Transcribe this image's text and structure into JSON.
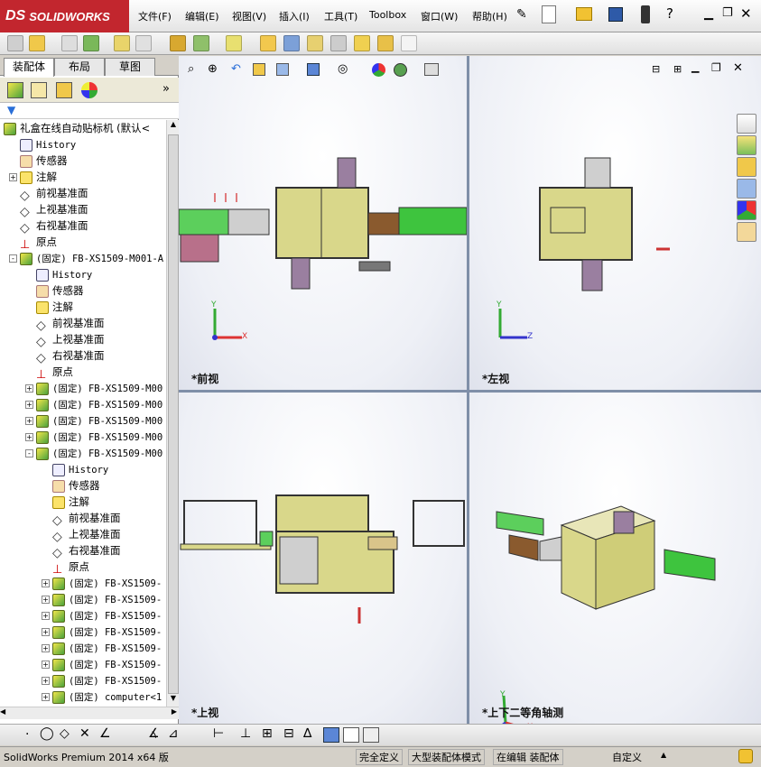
{
  "app": {
    "brand": "SOLIDWORKS",
    "brand_mark": "DS"
  },
  "menu": [
    "文件(F)",
    "编辑(E)",
    "视图(V)",
    "插入(I)",
    "工具(T)",
    "Toolbox",
    "窗口(W)",
    "帮助(H)"
  ],
  "tabs": [
    "装配体",
    "布局",
    "草图"
  ],
  "tree": {
    "root": "礼盒在线自动贴标机  (默认<",
    "items": [
      {
        "icon": "hist",
        "label": "History",
        "indent": 1,
        "mono": true
      },
      {
        "icon": "sens",
        "label": "传感器",
        "indent": 1
      },
      {
        "icon": "note",
        "label": "注解",
        "indent": 1,
        "expand": "+"
      },
      {
        "icon": "plane",
        "label": "前视基准面",
        "indent": 1
      },
      {
        "icon": "plane",
        "label": "上视基准面",
        "indent": 1
      },
      {
        "icon": "plane",
        "label": "右视基准面",
        "indent": 1
      },
      {
        "icon": "orig",
        "label": "原点",
        "indent": 1
      },
      {
        "icon": "asm",
        "label": "(固定) FB-XS1509-M001-A",
        "indent": 1,
        "expand": "-",
        "mono": true
      },
      {
        "icon": "hist",
        "label": "History",
        "indent": 2,
        "mono": true
      },
      {
        "icon": "sens",
        "label": "传感器",
        "indent": 2
      },
      {
        "icon": "note",
        "label": "注解",
        "indent": 2
      },
      {
        "icon": "plane",
        "label": "前视基准面",
        "indent": 2
      },
      {
        "icon": "plane",
        "label": "上视基准面",
        "indent": 2
      },
      {
        "icon": "plane",
        "label": "右视基准面",
        "indent": 2
      },
      {
        "icon": "orig",
        "label": "原点",
        "indent": 2
      },
      {
        "icon": "asm",
        "label": "(固定) FB-XS1509-M00",
        "indent": 2,
        "expand": "+",
        "mono": true
      },
      {
        "icon": "asm",
        "label": "(固定) FB-XS1509-M00",
        "indent": 2,
        "expand": "+",
        "mono": true
      },
      {
        "icon": "asm",
        "label": "(固定) FB-XS1509-M00",
        "indent": 2,
        "expand": "+",
        "mono": true
      },
      {
        "icon": "asm",
        "label": "(固定) FB-XS1509-M00",
        "indent": 2,
        "expand": "+",
        "mono": true
      },
      {
        "icon": "asm",
        "label": "(固定) FB-XS1509-M00",
        "indent": 2,
        "expand": "-",
        "mono": true
      },
      {
        "icon": "hist",
        "label": "History",
        "indent": 3,
        "mono": true
      },
      {
        "icon": "sens",
        "label": "传感器",
        "indent": 3
      },
      {
        "icon": "note",
        "label": "注解",
        "indent": 3
      },
      {
        "icon": "plane",
        "label": "前视基准面",
        "indent": 3
      },
      {
        "icon": "plane",
        "label": "上视基准面",
        "indent": 3
      },
      {
        "icon": "plane",
        "label": "右视基准面",
        "indent": 3
      },
      {
        "icon": "orig",
        "label": "原点",
        "indent": 3
      },
      {
        "icon": "asm",
        "label": "(固定) FB-XS1509-",
        "indent": 3,
        "expand": "+",
        "mono": true
      },
      {
        "icon": "asm",
        "label": "(固定) FB-XS1509-",
        "indent": 3,
        "expand": "+",
        "mono": true
      },
      {
        "icon": "asm",
        "label": "(固定) FB-XS1509-",
        "indent": 3,
        "expand": "+",
        "mono": true
      },
      {
        "icon": "asm",
        "label": "(固定) FB-XS1509-",
        "indent": 3,
        "expand": "+",
        "mono": true
      },
      {
        "icon": "asm",
        "label": "(固定) FB-XS1509-",
        "indent": 3,
        "expand": "+",
        "mono": true
      },
      {
        "icon": "asm",
        "label": "(固定) FB-XS1509-",
        "indent": 3,
        "expand": "+",
        "mono": true
      },
      {
        "icon": "asm",
        "label": "(固定) FB-XS1509-",
        "indent": 3,
        "expand": "+",
        "mono": true
      },
      {
        "icon": "asm",
        "label": "(固定) computer<1",
        "indent": 3,
        "expand": "+",
        "mono": true
      }
    ]
  },
  "viewports": {
    "front": "*前视",
    "left": "*左视",
    "top": "*上视",
    "iso": "*上下二等角轴测"
  },
  "axes": {
    "x": "X",
    "y": "Y",
    "z": "Z"
  },
  "status": {
    "product": "SolidWorks Premium 2014 x64 版",
    "defined": "完全定义",
    "mode": "大型装配体模式",
    "editing": "在编辑 装配体",
    "units": "自定义",
    "units_arrow": "▲"
  },
  "colors": {
    "brand": "#c2262e",
    "machine": "#d9d78a",
    "conveyor": "#3ec43e",
    "purple": "#9a7fa0",
    "brown": "#8a5a2e"
  }
}
